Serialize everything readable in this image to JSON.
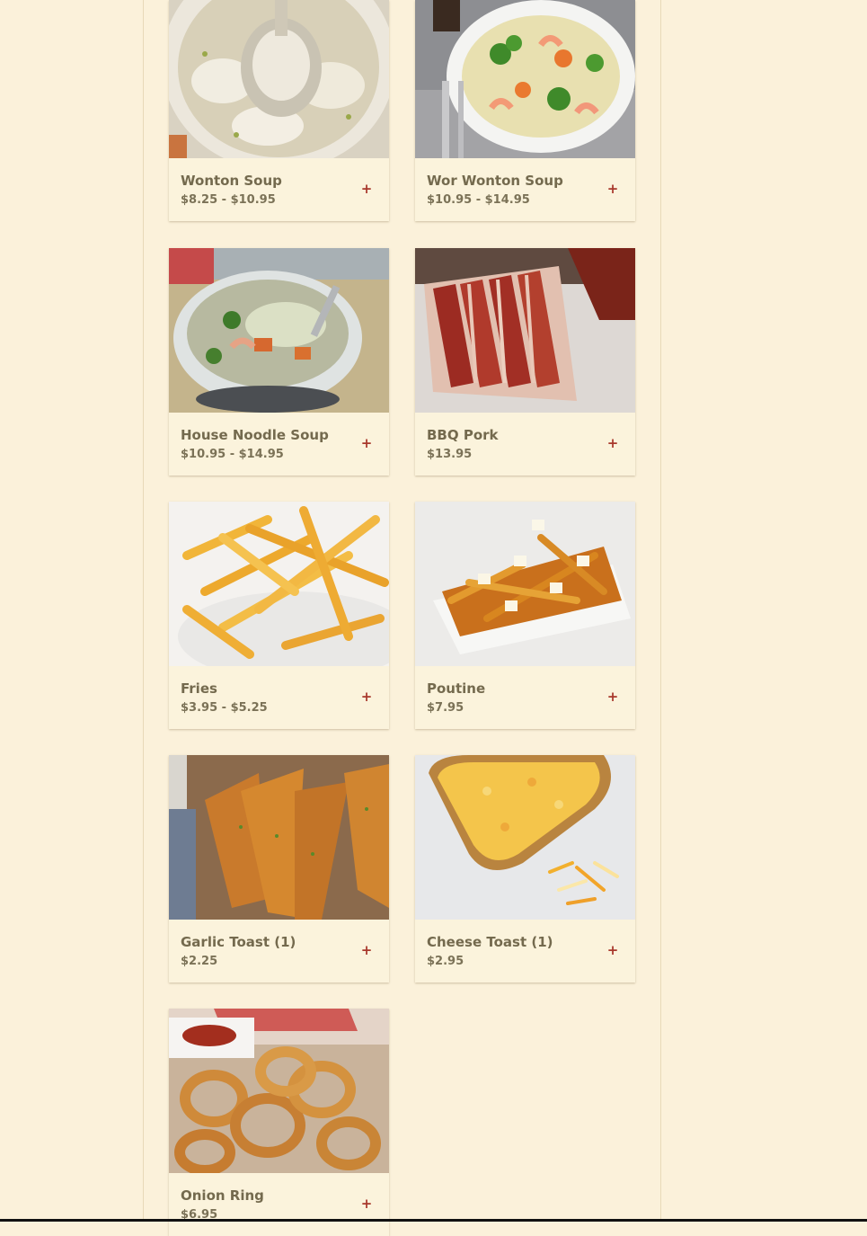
{
  "menu": {
    "items": [
      {
        "name": "Wonton Soup",
        "price": "$8.25 - $10.95",
        "add_label": "+",
        "image": "wonton-soup-photo"
      },
      {
        "name": "Wor Wonton Soup",
        "price": "$10.95 - $14.95",
        "add_label": "+",
        "image": "wor-wonton-soup-photo"
      },
      {
        "name": "House Noodle Soup",
        "price": "$10.95 - $14.95",
        "add_label": "+",
        "image": "house-noodle-soup-photo"
      },
      {
        "name": "BBQ Pork",
        "price": "$13.95",
        "add_label": "+",
        "image": "bbq-pork-photo"
      },
      {
        "name": "Fries",
        "price": "$3.95 - $5.25",
        "add_label": "+",
        "image": "fries-photo"
      },
      {
        "name": "Poutine",
        "price": "$7.95",
        "add_label": "+",
        "image": "poutine-photo"
      },
      {
        "name": "Garlic Toast (1)",
        "price": "$2.25",
        "add_label": "+",
        "image": "garlic-toast-photo"
      },
      {
        "name": "Cheese Toast (1)",
        "price": "$2.95",
        "add_label": "+",
        "image": "cheese-toast-photo"
      },
      {
        "name": "Onion Ring",
        "price": "$6.95",
        "add_label": "+",
        "image": "onion-ring-photo"
      }
    ]
  },
  "colors": {
    "page_background": "#fbf1da",
    "card_background": "#fbf3dc",
    "text": "#746a4e",
    "add_icon": "#a8382c"
  }
}
